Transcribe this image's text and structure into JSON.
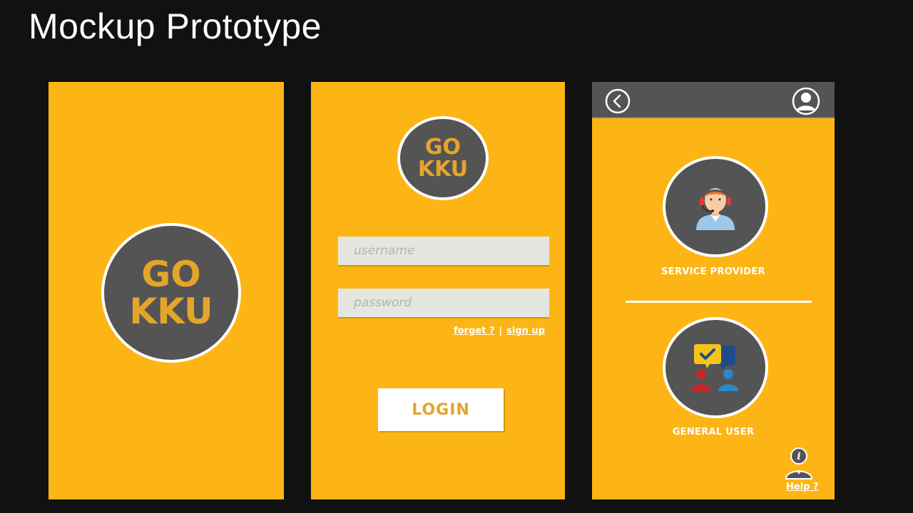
{
  "slide": {
    "title": "Mockup Prototype"
  },
  "colors": {
    "brand": "#FDB515",
    "dark_gray": "#545454",
    "logo_text": "#E4A52A",
    "background": "#111111"
  },
  "splash": {
    "logo_line1": "GO",
    "logo_line2": "KKU"
  },
  "login": {
    "logo_line1": "GO",
    "logo_line2": "KKU",
    "username": {
      "value": "",
      "placeholder": "username"
    },
    "password": {
      "value": "",
      "placeholder": "password"
    },
    "forget_label": "forget ?",
    "separator": "|",
    "signup_label": "sign up",
    "login_label": "LOGIN"
  },
  "role_select": {
    "topbar": {
      "back_icon": "chevron-left-circle-icon",
      "profile_icon": "user-circle-icon"
    },
    "roles": [
      {
        "label": "SERVICE PROVIDER",
        "icon": "headset-agent-icon"
      },
      {
        "label": "GENERAL USER",
        "icon": "chat-users-icon"
      }
    ],
    "help_label": "Help ?",
    "help_icon": "info-person-icon"
  }
}
